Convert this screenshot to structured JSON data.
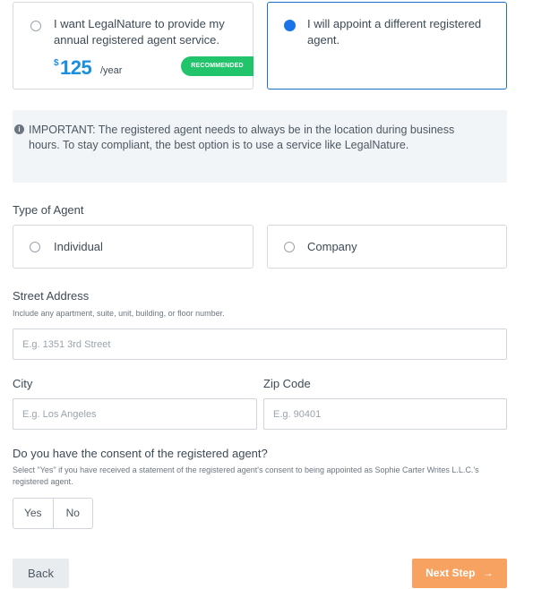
{
  "agent_service": {
    "option_legalnature": {
      "text": "I want LegalNature to provide my annual registered agent service.",
      "price_currency": "$",
      "price_amount": "125",
      "price_period": "/year",
      "badge": "RECOMMENDED",
      "selected": false
    },
    "option_different": {
      "text": "I will appoint a different registered agent.",
      "selected": true
    }
  },
  "notice": {
    "icon": "info-icon",
    "text": "IMPORTANT: The registered agent needs to always be in the location during business hours. To stay compliant, the best option is to use a service like LegalNature."
  },
  "agent_type": {
    "label": "Type of Agent",
    "options": [
      "Individual",
      "Company"
    ]
  },
  "street": {
    "label": "Street Address",
    "hint": "Include any apartment, suite, unit, building, or floor number.",
    "placeholder": "E.g. 1351 3rd Street",
    "value": ""
  },
  "city": {
    "label": "City",
    "placeholder": "E.g. Los Angeles",
    "value": ""
  },
  "zip": {
    "label": "Zip Code",
    "placeholder": "E.g. 90401",
    "value": ""
  },
  "consent": {
    "label": "Do you have the consent of the registered agent?",
    "hint": "Select \"Yes\" if you have received a statement of the registered agent's consent to being appointed as Sophie Carter Writes L.L.C.'s registered agent.",
    "yes": "Yes",
    "no": "No"
  },
  "nav": {
    "back": "Back",
    "next": "Next Step",
    "next_icon": "arrow-right-icon"
  },
  "colors": {
    "accent_blue": "#1a73e8",
    "price_blue": "#1a8fe0",
    "recommended_green": "#21c46a",
    "next_orange": "#f7a261"
  }
}
